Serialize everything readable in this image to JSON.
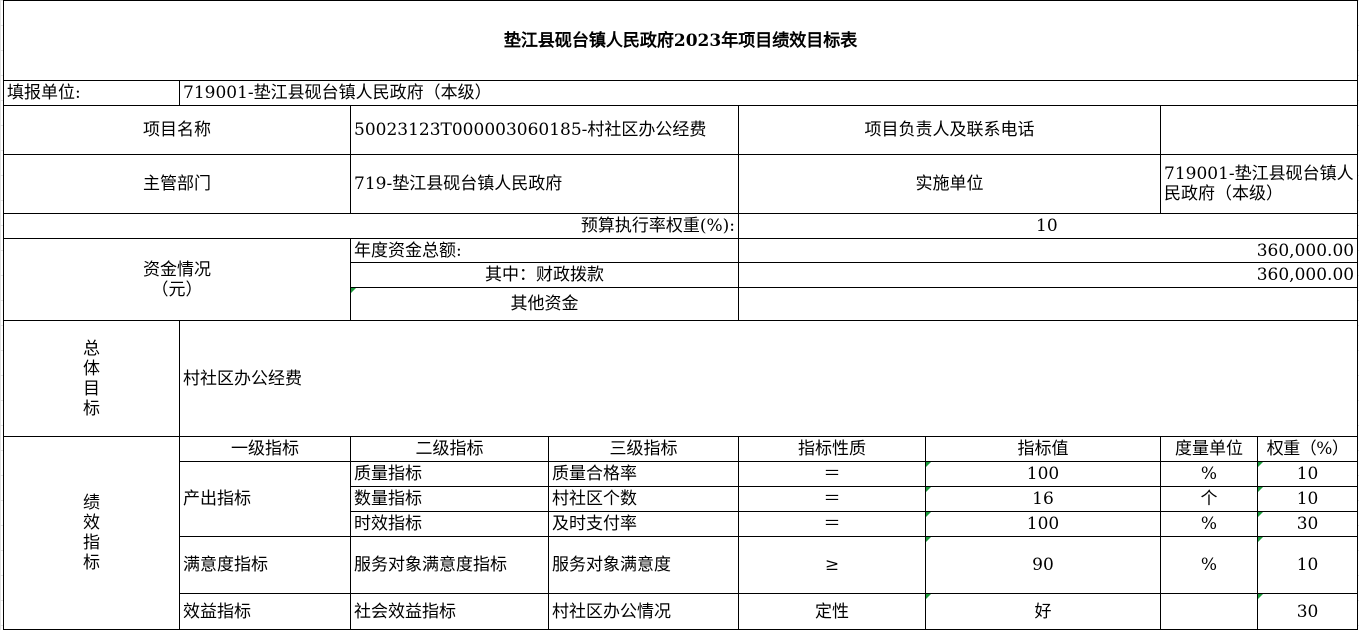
{
  "title": "垫江县砚台镇人民政府2023年项目绩效目标表",
  "fill_unit_label": "填报单位:",
  "fill_unit_value": "719001-垫江县砚台镇人民政府（本级）",
  "project_name_label": "项目名称",
  "project_name_value": "50023123T000003060185-村社区办公经费",
  "manager_label": "项目负责人及联系电话",
  "manager_value": "",
  "dept_label": "主管部门",
  "dept_value": "719-垫江县砚台镇人民政府",
  "impl_label": "实施单位",
  "impl_value": "719001-垫江县砚台镇人民政府（本级）",
  "budget_rate_label": "预算执行率权重(%):",
  "budget_rate_value": "10",
  "funds_label_1": "资金情况",
  "funds_label_2": "（元）",
  "annual_total_label": "年度资金总额:",
  "annual_total_value": "360,000.00",
  "fiscal_label": "其中：财政拨款",
  "fiscal_value": "360,000.00",
  "other_label": "其他资金",
  "other_value": "",
  "overall_goal_label": [
    "总",
    "体",
    "目",
    "标"
  ],
  "overall_goal_value": "村社区办公经费",
  "perf_label": [
    "绩",
    "效",
    "指",
    "标"
  ],
  "headers": [
    "一级指标",
    "二级指标",
    "三级指标",
    "指标性质",
    "指标值",
    "度量单位",
    "权重（%）"
  ],
  "level1": {
    "output": "产出指标",
    "satisfaction": "满意度指标",
    "benefit": "效益指标"
  },
  "rows": [
    {
      "l2": "质量指标",
      "l3": "质量合格率",
      "nature": "＝",
      "value": "100",
      "unit": "%",
      "weight": "10"
    },
    {
      "l2": "数量指标",
      "l3": "村社区个数",
      "nature": "＝",
      "value": "16",
      "unit": "个",
      "weight": "10"
    },
    {
      "l2": "时效指标",
      "l3": "及时支付率",
      "nature": "＝",
      "value": "100",
      "unit": "%",
      "weight": "30"
    },
    {
      "l2": "服务对象满意度指标",
      "l3": "服务对象满意度",
      "nature": "≥",
      "value": "90",
      "unit": "%",
      "weight": "10"
    },
    {
      "l2": "社会效益指标",
      "l3": "村社区办公情况",
      "nature": "定性",
      "value": "好",
      "unit": "",
      "weight": "30"
    }
  ]
}
